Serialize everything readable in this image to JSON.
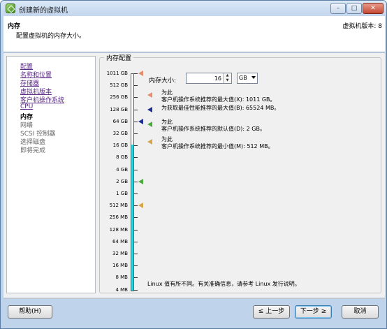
{
  "window": {
    "title": "创建新的虚拟机",
    "min": "–",
    "max": "□",
    "close": "✕"
  },
  "header": {
    "title": "内存",
    "subtitle": "配置虚拟机的内存大小。",
    "vm_version": "虚拟机版本: 8"
  },
  "sidebar": {
    "items": [
      {
        "label": "配置",
        "state": "link"
      },
      {
        "label": "名称和位置",
        "state": "link"
      },
      {
        "label": "存储器",
        "state": "link"
      },
      {
        "label": "虚拟机版本",
        "state": "link"
      },
      {
        "label": "客户机操作系统",
        "state": "link"
      },
      {
        "label": "CPU",
        "state": "link"
      },
      {
        "label": "内存",
        "state": "current"
      },
      {
        "label": "网络",
        "state": "future"
      },
      {
        "label": "SCSI 控制器",
        "state": "future"
      },
      {
        "label": "选择磁盘",
        "state": "future"
      },
      {
        "label": "即将完成",
        "state": "future"
      }
    ]
  },
  "memory_group": {
    "title": "内存配置",
    "scale_labels": [
      "1011 GB",
      "512 GB",
      "256 GB",
      "128 GB",
      "64 GB",
      "32 GB",
      "16 GB",
      "8 GB",
      "4 GB",
      "2 GB",
      "1 GB",
      "512 MB",
      "256 MB",
      "128 MB",
      "64 MB",
      "32 MB",
      "16 MB",
      "8 MB",
      "4 MB"
    ],
    "memory_size_label": "内存大小:",
    "memory_size_value": "16",
    "unit": "GB",
    "spinner_up": "▲",
    "spinner_down": "▼",
    "recommendations": [
      {
        "line1": "为此",
        "line2": "客户机操作系统推荐的最大值(X): 1011 GB。",
        "color": "#e38d6c"
      },
      {
        "line1": "",
        "line2": "为获取最佳性能推荐的最大值(B): 65524 MB。",
        "color": "#1d2f93"
      },
      {
        "line1": "为此",
        "line2": "客户机操作系统推荐的默认值(D): 2 GB。",
        "color": "#4caa3d"
      },
      {
        "line1": "为此",
        "line2": "客户机操作系统推荐的最小值(M): 512 MB。",
        "color": "#d7a44a"
      }
    ],
    "linux_note": "Linux 值有所不同。有关准确信息，请参考 Linux 发行说明。"
  },
  "buttons": {
    "help": "帮助(H)",
    "back": "≤ 上一步",
    "next": "下一步 ≥",
    "cancel": "取消"
  }
}
